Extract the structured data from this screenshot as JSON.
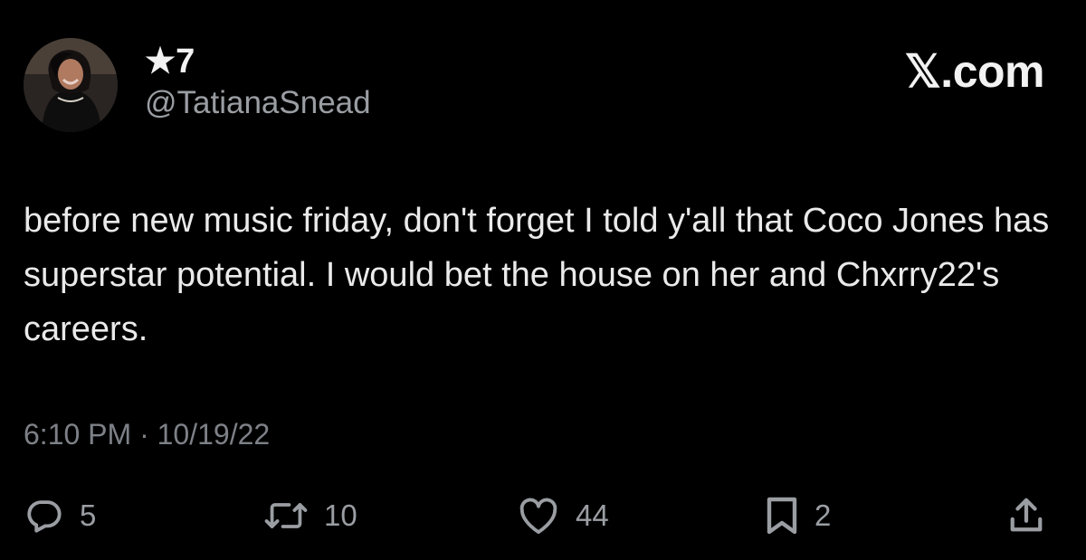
{
  "tweet": {
    "display_name": "★7",
    "handle": "@TatianaSnead",
    "brand": "𝕏.com",
    "text": "before new music friday, don't forget I told y'all that Coco Jones has superstar potential. I would bet the house on her and Chxrry22's careers.",
    "timestamp": "6:10 PM · 10/19/22"
  },
  "actions": {
    "replies": "5",
    "reposts": "10",
    "likes": "44",
    "bookmarks": "2"
  },
  "icons": {
    "reply": "reply-icon",
    "repost": "repost-icon",
    "like": "heart-icon",
    "bookmark": "bookmark-icon",
    "share": "share-icon"
  },
  "colors": {
    "background": "#000000",
    "text": "#e7e9ea",
    "muted": "#9a9ea3"
  }
}
